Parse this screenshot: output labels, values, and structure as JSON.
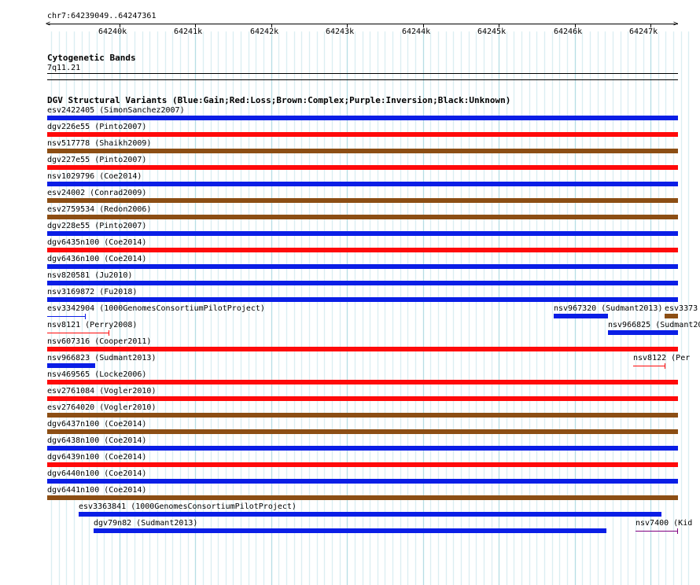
{
  "location": "chr7:64239049..64247361",
  "ruler": {
    "ticks": [
      "64240k",
      "64241k",
      "64242k",
      "64243k",
      "64244k",
      "64245k",
      "64246k",
      "64247k"
    ]
  },
  "cyto": {
    "title": "Cytogenetic Bands",
    "band": "7q11.21"
  },
  "dgv": {
    "title": "DGV Structural Variants (Blue:Gain;Red:Loss;Brown:Complex;Purple:Inversion;Black:Unknown)",
    "colors": {
      "gain": "#0a1ee6",
      "loss": "#ff0a0a",
      "complex": "#8c4e14",
      "inversion": "#800080",
      "unknown": "#000000"
    },
    "features": [
      {
        "label": "esv2422405 (SimonSanchez2007)",
        "type": "gain",
        "start": 64238400,
        "end": 64247361
      },
      {
        "label": "dgv226e55 (Pinto2007)",
        "type": "loss",
        "start": 64238400,
        "end": 64247361
      },
      {
        "label": "nsv517778 (Shaikh2009)",
        "type": "complex",
        "start": 64238400,
        "end": 64247361
      },
      {
        "label": "dgv227e55 (Pinto2007)",
        "type": "loss",
        "start": 64238400,
        "end": 64247361
      },
      {
        "label": "nsv1029796 (Coe2014)",
        "type": "gain",
        "start": 64238400,
        "end": 64247361
      },
      {
        "label": "esv24002 (Conrad2009)",
        "type": "complex",
        "start": 64238400,
        "end": 64247361
      },
      {
        "label": "esv2759534 (Redon2006)",
        "type": "complex",
        "start": 64238400,
        "end": 64247361
      },
      {
        "label": "dgv228e55 (Pinto2007)",
        "type": "gain",
        "start": 64238400,
        "end": 64247361
      },
      {
        "label": "dgv6435n100 (Coe2014)",
        "type": "loss",
        "start": 64238400,
        "end": 64247361
      },
      {
        "label": "dgv6436n100 (Coe2014)",
        "type": "gain",
        "start": 64238400,
        "end": 64247361
      },
      {
        "label": "nsv820581 (Ju2010)",
        "type": "gain",
        "start": 64238400,
        "end": 64247361
      },
      {
        "label": "nsv3169872 (Fu2018)",
        "type": "gain",
        "start": 64238400,
        "end": 64247361
      },
      {
        "label": "esv3342904 (1000GenomesConsortiumPilotProject)",
        "type": "gain",
        "start": 64239049,
        "end": 64239560,
        "thin": true
      },
      {
        "label": "nsv967320 (Sudmant2013)",
        "type": "gain",
        "start": 64245720,
        "end": 64246440
      },
      {
        "label": "esv3373",
        "type": "complex",
        "start": 64247180,
        "end": 64247361
      },
      {
        "label": "nsv8121 (Perry2008)",
        "type": "loss",
        "start": 64239049,
        "end": 64239870,
        "thin": true
      },
      {
        "label": "nsv966825 (Sudmant2013)",
        "type": "gain",
        "start": 64246440,
        "end": 64247361
      },
      {
        "label": "nsv607316 (Cooper2011)",
        "type": "loss",
        "start": 64238400,
        "end": 64247361
      },
      {
        "label": "nsv966823 (Sudmant2013)",
        "type": "gain",
        "start": 64239049,
        "end": 64239680
      },
      {
        "label": "nsv8122 (Per",
        "type": "loss",
        "start": 64246770,
        "end": 64247200,
        "thin": true
      },
      {
        "label": "nsv469565 (Locke2006)",
        "type": "loss",
        "start": 64238400,
        "end": 64247361
      },
      {
        "label": "esv2761084 (Vogler2010)",
        "type": "loss",
        "start": 64238400,
        "end": 64247361
      },
      {
        "label": "esv2764020 (Vogler2010)",
        "type": "complex",
        "start": 64238400,
        "end": 64247361
      },
      {
        "label": "dgv6437n100 (Coe2014)",
        "type": "complex",
        "start": 64238400,
        "end": 64247361
      },
      {
        "label": "dgv6438n100 (Coe2014)",
        "type": "gain",
        "start": 64238400,
        "end": 64247361
      },
      {
        "label": "dgv6439n100 (Coe2014)",
        "type": "loss",
        "start": 64238400,
        "end": 64247361
      },
      {
        "label": "dgv6440n100 (Coe2014)",
        "type": "gain",
        "start": 64238400,
        "end": 64247361
      },
      {
        "label": "dgv6441n100 (Coe2014)",
        "type": "complex",
        "start": 64238400,
        "end": 64247361
      },
      {
        "label": "esv3363841 (1000GenomesConsortiumPilotProject)",
        "type": "gain",
        "start": 64239460,
        "end": 64247140
      },
      {
        "label": "dgv79n82 (Sudmant2013)",
        "type": "gain",
        "start": 64239660,
        "end": 64246420
      },
      {
        "label": "nsv7400 (Kid",
        "type": "inversion",
        "start": 64246800,
        "end": 64247361,
        "thin": true
      }
    ]
  }
}
